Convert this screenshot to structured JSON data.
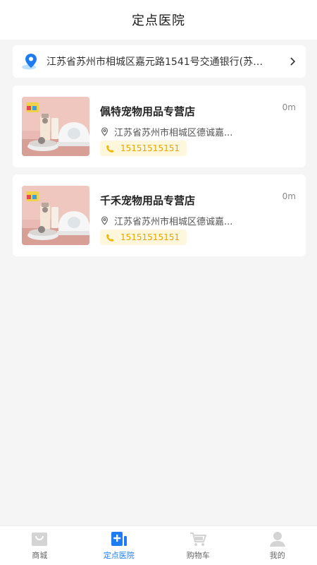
{
  "header": {
    "title": "定点医院"
  },
  "location": {
    "address": "江苏省苏州市相城区嘉元路1541号交通银行(苏…"
  },
  "stores": [
    {
      "name": "佩特宠物用品专营店",
      "distance": "0m",
      "address": "江苏省苏州市相城区德诚嘉...",
      "phone": "15151515151"
    },
    {
      "name": "千禾宠物用品专营店",
      "distance": "0m",
      "address": "江苏省苏州市相城区德诚嘉...",
      "phone": "15151515151"
    }
  ],
  "tabbar": {
    "items": [
      {
        "label": "商城",
        "icon": "mall-icon"
      },
      {
        "label": "定点医院",
        "icon": "hospital-icon",
        "active": true
      },
      {
        "label": "购物车",
        "icon": "cart-icon"
      },
      {
        "label": "我的",
        "icon": "profile-icon"
      }
    ]
  },
  "colors": {
    "accent": "#1e7cf2",
    "phone_text": "#e8a400",
    "phone_bg": "#fff7dc",
    "background": "#f5f5f5"
  }
}
